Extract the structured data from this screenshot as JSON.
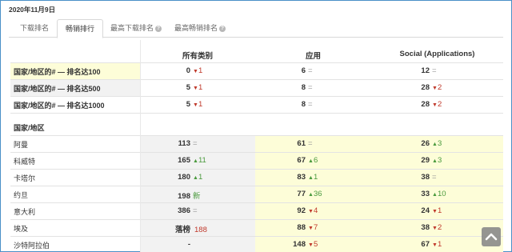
{
  "date": "2020年11月9日",
  "tabs": [
    {
      "label": "下载排名",
      "help": false,
      "active": false
    },
    {
      "label": "畅销排行",
      "help": false,
      "active": true
    },
    {
      "label": "最高下载排名",
      "help": true,
      "active": false
    },
    {
      "label": "最高畅销排名",
      "help": true,
      "active": false
    }
  ],
  "columns": [
    "所有类别",
    "应用",
    "Social (Applications)"
  ],
  "summary_rows": [
    {
      "label": "国家/地区的# — 排名达100",
      "cells": [
        {
          "value": "0",
          "trend": "down",
          "change": "1"
        },
        {
          "value": "6",
          "trend": "eq",
          "change": ""
        },
        {
          "value": "12",
          "trend": "eq",
          "change": ""
        }
      ]
    },
    {
      "label": "国家/地区的# — 排名达500",
      "cells": [
        {
          "value": "5",
          "trend": "down",
          "change": "1"
        },
        {
          "value": "8",
          "trend": "eq",
          "change": ""
        },
        {
          "value": "28",
          "trend": "down",
          "change": "2"
        }
      ]
    },
    {
      "label": "国家/地区的# — 排名达1000",
      "cells": [
        {
          "value": "5",
          "trend": "down",
          "change": "1"
        },
        {
          "value": "8",
          "trend": "eq",
          "change": ""
        },
        {
          "value": "28",
          "trend": "down",
          "change": "2"
        }
      ]
    }
  ],
  "country_section_title": "国家/地区",
  "country_rows": [
    {
      "label": "阿曼",
      "cells": [
        {
          "value": "113",
          "trend": "eq",
          "change": ""
        },
        {
          "value": "61",
          "trend": "eq",
          "change": ""
        },
        {
          "value": "26",
          "trend": "up",
          "change": "3"
        }
      ]
    },
    {
      "label": "科威特",
      "cells": [
        {
          "value": "165",
          "trend": "up",
          "change": "11"
        },
        {
          "value": "67",
          "trend": "up",
          "change": "6"
        },
        {
          "value": "29",
          "trend": "up",
          "change": "3"
        }
      ]
    },
    {
      "label": "卡塔尔",
      "cells": [
        {
          "value": "180",
          "trend": "up",
          "change": "1"
        },
        {
          "value": "83",
          "trend": "up",
          "change": "1"
        },
        {
          "value": "38",
          "trend": "eq",
          "change": ""
        }
      ]
    },
    {
      "label": "约旦",
      "cells": [
        {
          "value": "198",
          "trend": "new",
          "change": "新"
        },
        {
          "value": "77",
          "trend": "up",
          "change": "36"
        },
        {
          "value": "33",
          "trend": "up",
          "change": "10"
        }
      ]
    },
    {
      "label": "意大利",
      "cells": [
        {
          "value": "386",
          "trend": "eq",
          "change": ""
        },
        {
          "value": "92",
          "trend": "down",
          "change": "4"
        },
        {
          "value": "24",
          "trend": "down",
          "change": "1"
        }
      ]
    },
    {
      "label": "埃及",
      "cells": [
        {
          "value": "落榜",
          "trend": "drop",
          "change": "188"
        },
        {
          "value": "88",
          "trend": "down",
          "change": "7"
        },
        {
          "value": "38",
          "trend": "down",
          "change": "2"
        }
      ]
    },
    {
      "label": "沙特阿拉伯",
      "cells": [
        {
          "value": "-",
          "trend": "none",
          "change": ""
        },
        {
          "value": "148",
          "trend": "down",
          "change": "5"
        },
        {
          "value": "67",
          "trend": "down",
          "change": "1"
        }
      ]
    }
  ],
  "colors": {
    "up": "#4a9a3d",
    "down": "#c0392b",
    "highlight": "#fdfdd8",
    "accent": "#4a90c8"
  },
  "scroll_top_icon": "chevron-up-icon"
}
